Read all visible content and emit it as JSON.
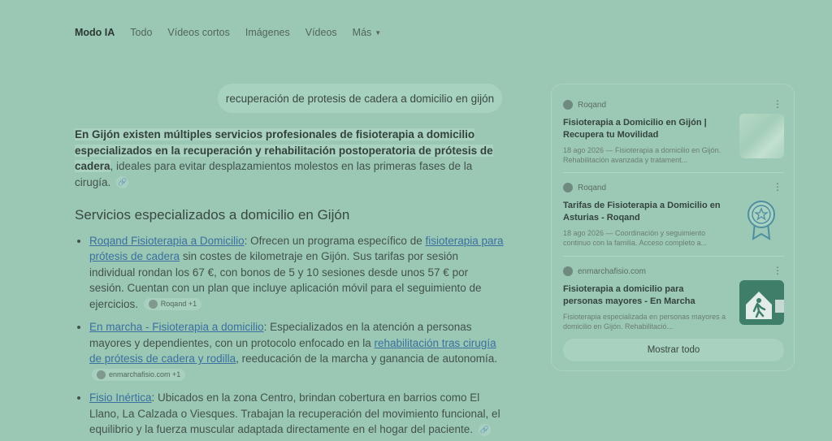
{
  "nav": {
    "tabs": [
      "Modo IA",
      "Todo",
      "Vídeos cortos",
      "Imágenes",
      "Vídeos"
    ],
    "more_label": "Más"
  },
  "query": "recuperación de protesis de cadera a domicilio en gijón",
  "answer": {
    "intro_highlight": "En Gijón existen múltiples servicios profesionales de fisioterapia a domicilio especializados en la recuperación y rehabilitación postoperatoria de prótesis de cadera",
    "intro_rest": ", ideales para evitar desplazamientos molestos en las primeras fases de la cirugía.",
    "section_title": "Servicios especializados a domicilio en Gijón",
    "items": [
      {
        "link1": "Roqand Fisioterapia a Domicilio",
        "text1": ": Ofrecen un programa específico de ",
        "link2": "fisioterapia para prótesis de cadera",
        "text2": " sin costes de kilometraje en Gijón. Sus tarifas por sesión individual rondan los 67 €, con bonos de 5 y 10 sesiones desde unos 57 € por sesión. Cuentan con un plan que incluye aplicación móvil para el seguimiento de ejercicios.",
        "chip": "Roqand +1"
      },
      {
        "link1": "En marcha - Fisioterapia a domicilio",
        "text1": ": Especializados en la atención a personas mayores y dependientes, con un protocolo enfocado en la ",
        "link2": "rehabilitación tras cirugía de prótesis de cadera y rodilla",
        "text2": ", reeducación de la marcha y ganancia de autonomía.",
        "chip": "enmarchafisio.com +1"
      },
      {
        "link1": "Fisio Inértica",
        "text1": ": Ubicados en la zona Centro, brindan cobertura en barrios como El Llano, La Calzada o Viesques. Trabajan la recuperación del movimiento funcional, el equilibrio y la fuerza muscular adaptada directamente en el hogar del paciente."
      }
    ]
  },
  "panel": {
    "cards": [
      {
        "source": "Roqand",
        "title": "Fisioterapia a Domicilio en Gijón | Recupera tu Movilidad",
        "snippet": "18 ago 2026 — Fisioterapia a domicilio en Gijón. Rehabilitación avanzada y tratament..."
      },
      {
        "source": "Roqand",
        "title": "Tarifas de Fisioterapia a Domicilio en Asturias - Roqand",
        "snippet": "18 ago 2026 — Coordinación y seguimiento continuo con la familia. Acceso completo a..."
      },
      {
        "source": "enmarchafisio.com",
        "title": "Fisioterapia a domicilio para personas mayores - En Marcha",
        "snippet": "Fisioterapia especializada en personas mayores a domicilio en Gijón. Rehabilitació..."
      }
    ],
    "show_all": "Mostrar todo"
  },
  "colors": {
    "background": "#9bc8b4",
    "link": "#3b6fa0"
  }
}
